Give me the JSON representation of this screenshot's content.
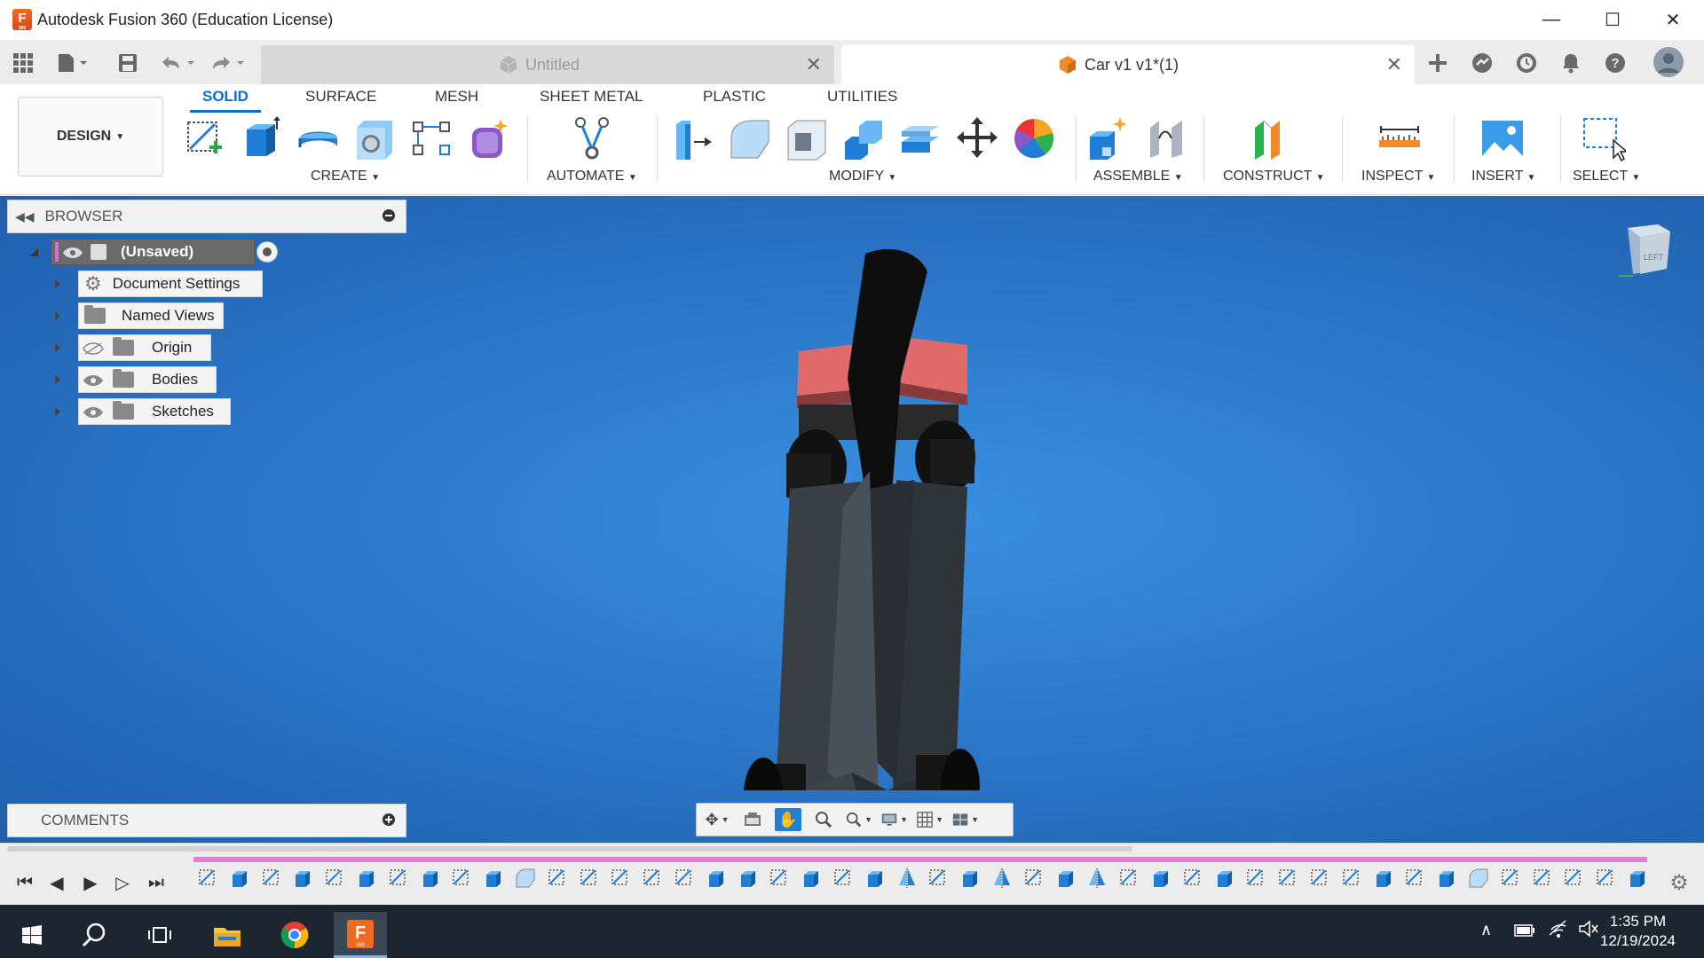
{
  "window": {
    "title": "Autodesk Fusion 360 (Education License)",
    "logo_letter": "F",
    "logo_sub": "360"
  },
  "tabs": [
    {
      "label": "Untitled",
      "active": false
    },
    {
      "label": "Car v1 v1*(1)",
      "active": true
    }
  ],
  "ribbon": {
    "workspace": "DESIGN",
    "tabs": [
      "SOLID",
      "SURFACE",
      "MESH",
      "SHEET METAL",
      "PLASTIC",
      "UTILITIES"
    ],
    "groups": {
      "create": "CREATE",
      "automate": "AUTOMATE",
      "modify": "MODIFY",
      "assemble": "ASSEMBLE",
      "construct": "CONSTRUCT",
      "inspect": "INSPECT",
      "insert": "INSERT",
      "select": "SELECT"
    }
  },
  "browser": {
    "title": "BROWSER",
    "root": "(Unsaved)",
    "items": [
      "Document Settings",
      "Named Views",
      "Origin",
      "Bodies",
      "Sketches"
    ]
  },
  "comments": {
    "title": "COMMENTS"
  },
  "viewcube": {
    "face": "LEFT"
  },
  "colors": {
    "accent": "#0a6fd1",
    "viewport": "#2a74c6",
    "timeline_track": "#e07fd6",
    "taskbar": "#1c2530"
  },
  "taskbar": {
    "time": "1:35 PM",
    "date": "12/19/2024"
  }
}
